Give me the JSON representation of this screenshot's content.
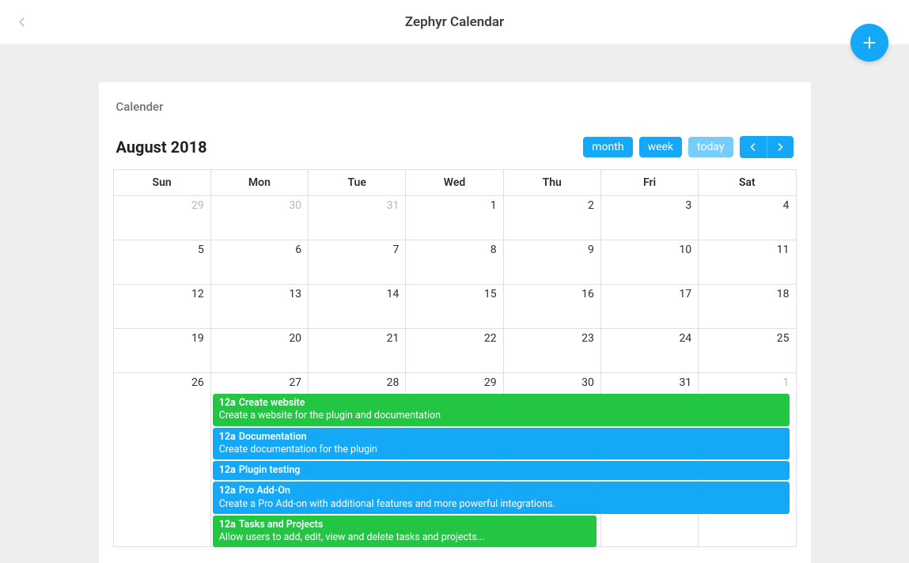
{
  "app_title": "Zephyr Calendar",
  "card_title": "Calender",
  "month_label": "August 2018",
  "buttons": {
    "month": "month",
    "week": "week",
    "today": "today"
  },
  "day_headers": [
    "Sun",
    "Mon",
    "Tue",
    "Wed",
    "Thu",
    "Fri",
    "Sat"
  ],
  "weeks": [
    [
      {
        "n": "29",
        "muted": true
      },
      {
        "n": "30",
        "muted": true
      },
      {
        "n": "31",
        "muted": true
      },
      {
        "n": "1"
      },
      {
        "n": "2"
      },
      {
        "n": "3"
      },
      {
        "n": "4"
      }
    ],
    [
      {
        "n": "5"
      },
      {
        "n": "6"
      },
      {
        "n": "7"
      },
      {
        "n": "8"
      },
      {
        "n": "9"
      },
      {
        "n": "10"
      },
      {
        "n": "11"
      }
    ],
    [
      {
        "n": "12"
      },
      {
        "n": "13"
      },
      {
        "n": "14"
      },
      {
        "n": "15"
      },
      {
        "n": "16"
      },
      {
        "n": "17"
      },
      {
        "n": "18"
      }
    ],
    [
      {
        "n": "19"
      },
      {
        "n": "20"
      },
      {
        "n": "21"
      },
      {
        "n": "22"
      },
      {
        "n": "23"
      },
      {
        "n": "24"
      },
      {
        "n": "25"
      }
    ],
    [
      {
        "n": "26"
      },
      {
        "n": "27"
      },
      {
        "n": "28"
      },
      {
        "n": "29"
      },
      {
        "n": "30"
      },
      {
        "n": "31"
      },
      {
        "n": "1",
        "muted": true
      }
    ]
  ],
  "event_row_index": 4,
  "event_start_col": 1,
  "events": [
    {
      "time": "12a",
      "title": "Create website",
      "desc": "Create a website for the plugin and documentation",
      "color": "green",
      "span": 6
    },
    {
      "time": "12a",
      "title": "Documentation",
      "desc": "Create documentation for the plugin",
      "color": "blue",
      "span": 6
    },
    {
      "time": "12a",
      "title": "Plugin testing",
      "desc": "",
      "color": "blue",
      "span": 6
    },
    {
      "time": "12a",
      "title": "Pro Add-On",
      "desc": "Create a Pro Add-on with additional features and more powerful integrations.",
      "color": "blue",
      "span": 6
    },
    {
      "time": "12a",
      "title": "Tasks and Projects",
      "desc": "Allow users to add, edit, view and delete tasks and projects...",
      "color": "green",
      "span": 4
    }
  ]
}
